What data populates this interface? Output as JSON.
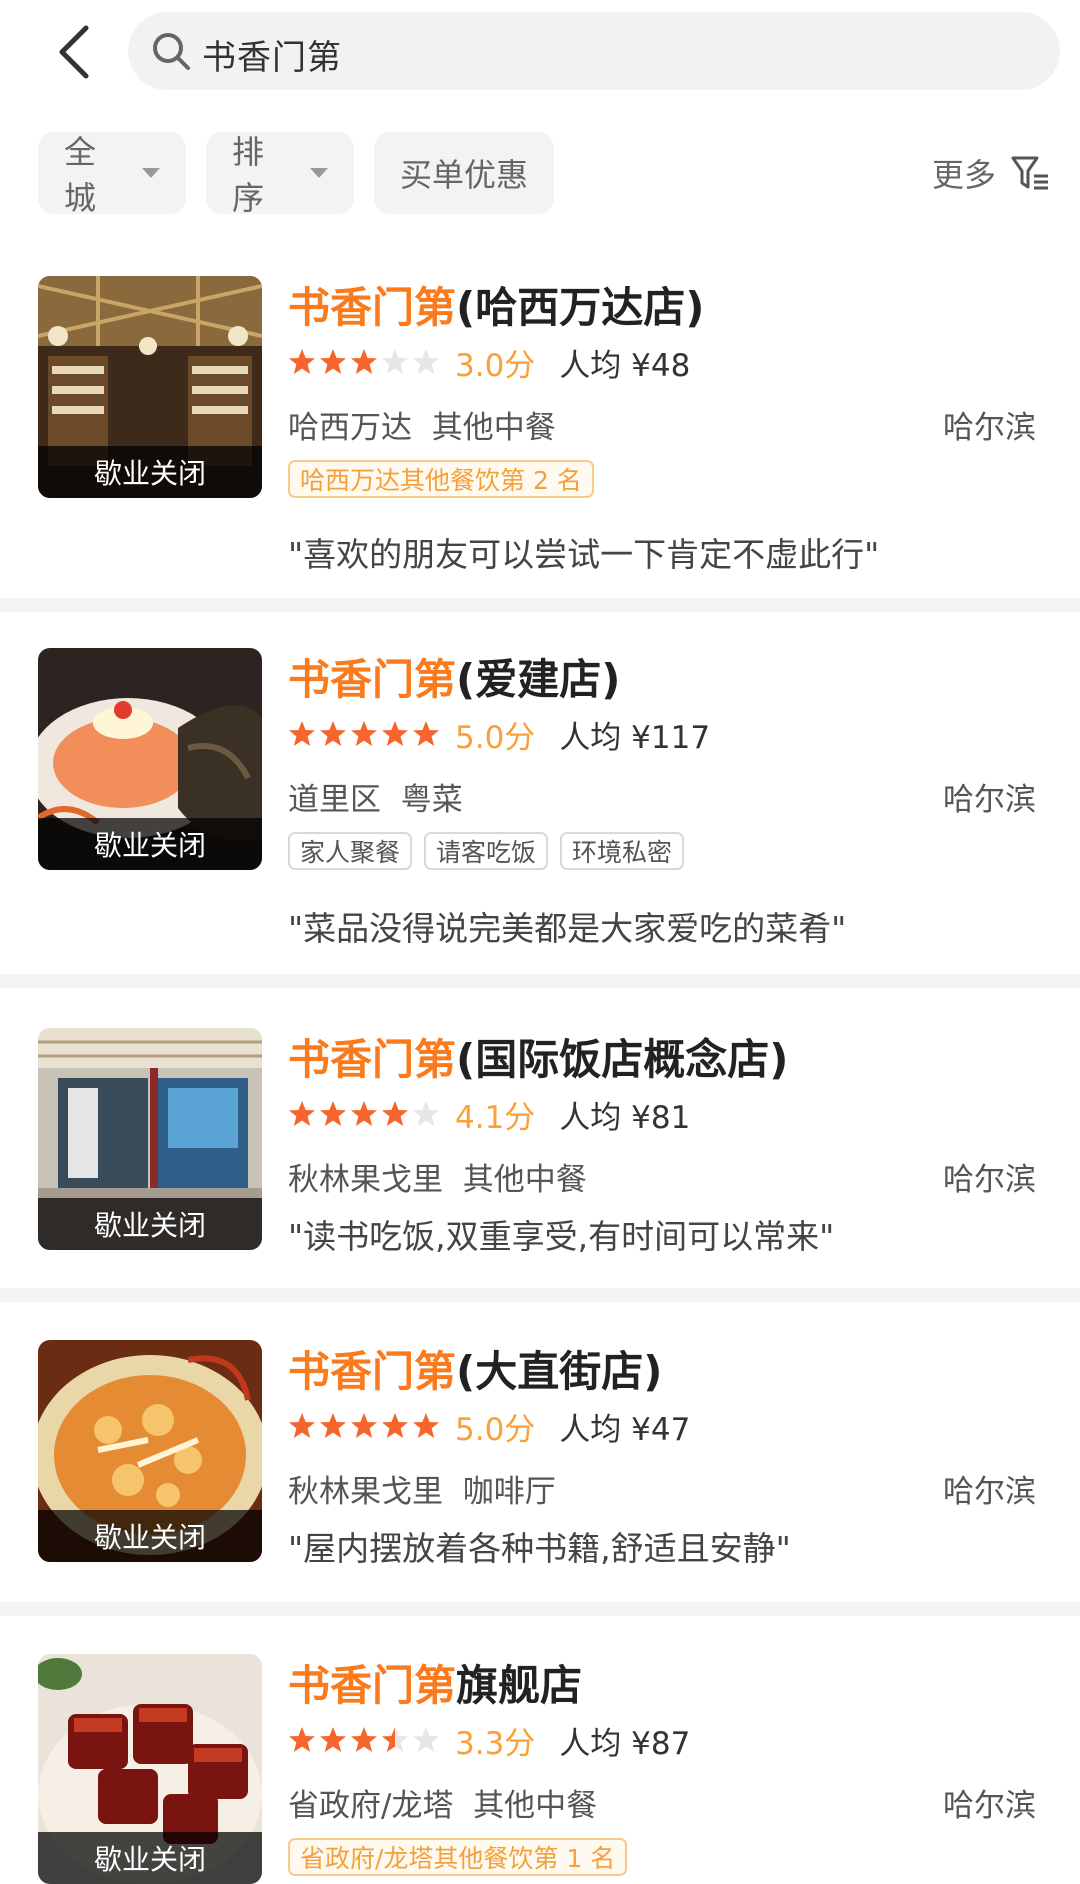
{
  "search": {
    "query": "书香门第"
  },
  "filters": {
    "chips": [
      {
        "label": "全城",
        "dropdown": true
      },
      {
        "label": "排序",
        "dropdown": true
      },
      {
        "label": "买单优惠",
        "dropdown": false
      }
    ],
    "more_label": "更多"
  },
  "colors": {
    "highlight": "#f97b1d",
    "star": "#f5652c",
    "score": "#f9a03b"
  },
  "results": [
    {
      "name_highlight": "书香门第",
      "name_rest": "(哈西万达店)",
      "stars": 3,
      "score": "3.0分",
      "avg_price": "人均 ¥48",
      "area": "哈西万达",
      "category": "其他中餐",
      "city": "哈尔滨",
      "status": "歇业关闭",
      "rank_badge": "哈西万达其他餐饮第 2 名",
      "tags": [],
      "quote": "\"喜欢的朋友可以尝试一下肯定不虚此行\"",
      "photo": "bookstore-interior"
    },
    {
      "name_highlight": "书香门第",
      "name_rest": "(爱建店)",
      "stars": 5,
      "score": "5.0分",
      "avg_price": "人均 ¥117",
      "area": "道里区",
      "category": "粤菜",
      "city": "哈尔滨",
      "status": "歇业关闭",
      "rank_badge": "",
      "tags": [
        "家人聚餐",
        "请客吃饭",
        "环境私密"
      ],
      "quote": "\"菜品没得说完美都是大家爱吃的菜肴\"",
      "photo": "lobster-dish"
    },
    {
      "name_highlight": "书香门第",
      "name_rest": "(国际饭店概念店)",
      "stars": 4,
      "score": "4.1分",
      "avg_price": "人均 ¥81",
      "area": "秋林果戈里",
      "category": "其他中餐",
      "city": "哈尔滨",
      "status": "歇业关闭",
      "rank_badge": "",
      "tags": [],
      "quote": "\"读书吃饭,双重享受,有时间可以常来\"",
      "photo": "storefront"
    },
    {
      "name_highlight": "书香门第",
      "name_rest": "(大直街店)",
      "stars": 5,
      "score": "5.0分",
      "avg_price": "人均 ¥47",
      "area": "秋林果戈里",
      "category": "咖啡厅",
      "city": "哈尔滨",
      "status": "歇业关闭",
      "rank_badge": "",
      "tags": [],
      "quote": "\"屋内摆放着各种书籍,舒适且安静\"",
      "photo": "shrimp-plate"
    },
    {
      "name_highlight": "书香门第",
      "name_rest": "旗舰店",
      "stars": 3.5,
      "score": "3.3分",
      "avg_price": "人均 ¥87",
      "area": "省政府/龙塔",
      "category": "其他中餐",
      "city": "哈尔滨",
      "status": "歇业关闭",
      "rank_badge": "省政府/龙塔其他餐饮第 1 名",
      "tags": [],
      "quote": "",
      "photo": "braised-pork"
    }
  ]
}
